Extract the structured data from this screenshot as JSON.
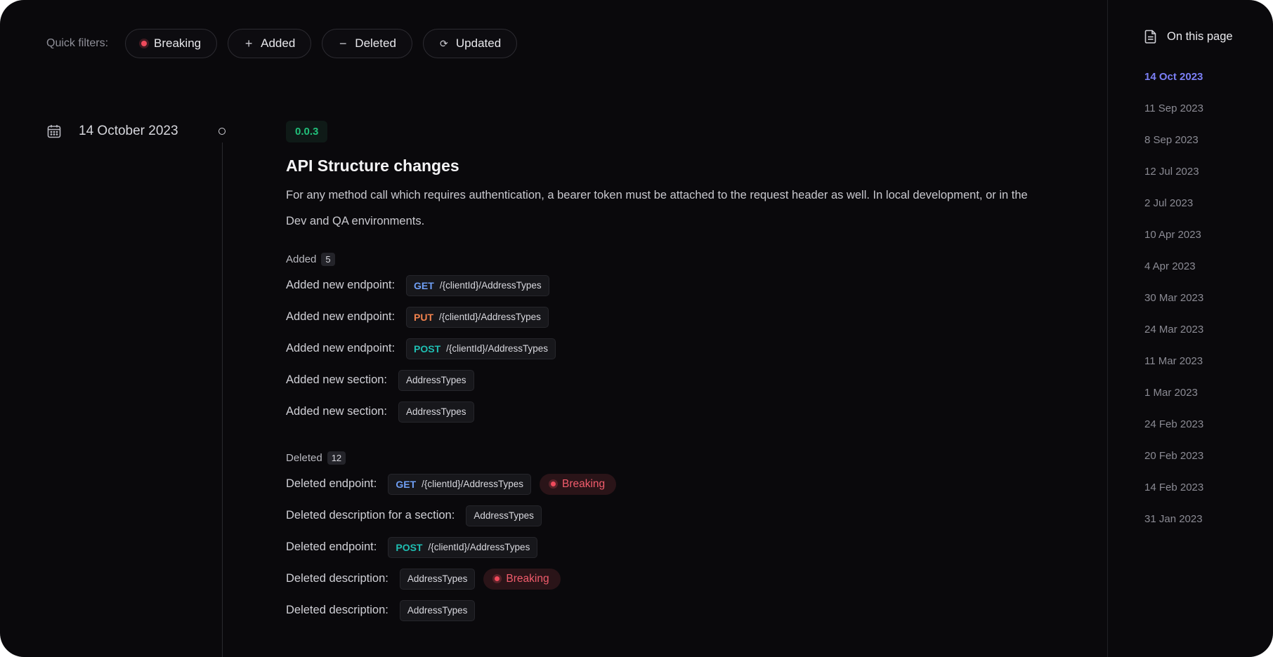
{
  "filters": {
    "label": "Quick filters:",
    "items": [
      {
        "label": "Breaking",
        "icon": "red-dot-icon"
      },
      {
        "label": "Added",
        "icon": "plus-icon"
      },
      {
        "label": "Deleted",
        "icon": "minus-icon"
      },
      {
        "label": "Updated",
        "icon": "refresh-icon"
      }
    ]
  },
  "entry": {
    "date": "14 October 2023",
    "version": "0.0.3",
    "title": "API Structure changes",
    "description": "For any method call which requires authentication, a bearer token must be attached to the request header as well. In local development, or in the Dev and QA environments."
  },
  "added": {
    "label": "Added",
    "count": "5",
    "rows": [
      {
        "text": "Added new endpoint:",
        "method": "GET",
        "path": "/{clientId}/AddressTypes"
      },
      {
        "text": "Added new endpoint:",
        "method": "PUT",
        "path": "/{clientId}/AddressTypes"
      },
      {
        "text": "Added new endpoint:",
        "method": "POST",
        "path": "/{clientId}/AddressTypes"
      },
      {
        "text": "Added new section:",
        "tag": "AddressTypes"
      },
      {
        "text": "Added new section:",
        "tag": "AddressTypes"
      }
    ]
  },
  "deleted": {
    "label": "Deleted",
    "count": "12",
    "rows": [
      {
        "text": "Deleted endpoint:",
        "method": "GET",
        "path": "/{clientId}/AddressTypes",
        "breaking": "Breaking"
      },
      {
        "text": "Deleted description for a section:",
        "tag": "AddressTypes"
      },
      {
        "text": "Deleted endpoint:",
        "method": "POST",
        "path": "/{clientId}/AddressTypes"
      },
      {
        "text": "Deleted description:",
        "tag": "AddressTypes",
        "breaking": "Breaking"
      },
      {
        "text": "Deleted description:",
        "tag": "AddressTypes"
      }
    ]
  },
  "aside": {
    "title": "On this page",
    "items": [
      "14 Oct 2023",
      "11 Sep 2023",
      "8 Sep 2023",
      "12 Jul 2023",
      "2 Jul 2023",
      "10 Apr 2023",
      "4 Apr 2023",
      "30 Mar 2023",
      "24 Mar 2023",
      "11 Mar 2023",
      "1 Mar 2023",
      "24 Feb 2023",
      "20 Feb 2023",
      "14 Feb 2023",
      "31 Jan 2023"
    ],
    "active_index": 0
  },
  "colors": {
    "background": "#0a090c",
    "breaking": "#f04a5c",
    "version": "#21c07a",
    "active_link": "#7b7ff5",
    "get": "#6f9ff5",
    "put": "#f2824d",
    "post": "#1fbfb3"
  }
}
